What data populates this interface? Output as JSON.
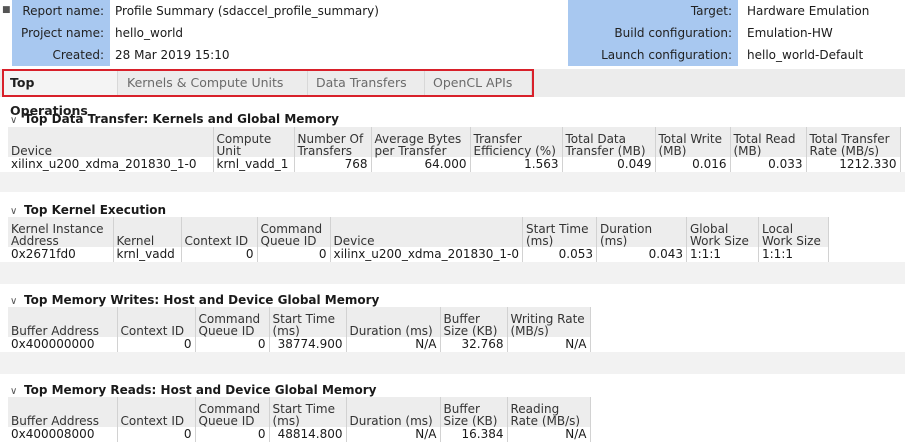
{
  "header": {
    "report_name_label": "Report name:",
    "report_name": "Profile Summary (sdaccel_profile_summary)",
    "project_name_label": "Project name:",
    "project_name": "hello_world",
    "created_label": "Created:",
    "created": "28 Mar 2019 15:10",
    "target_label": "Target:",
    "target": "Hardware Emulation",
    "build_config_label": "Build configuration:",
    "build_config": "Emulation-HW",
    "launch_config_label": "Launch configuration:",
    "launch_config": "hello_world-Default"
  },
  "tabs": [
    "Top Operations",
    "Kernels & Compute Units",
    "Data Transfers",
    "OpenCL APIs"
  ],
  "sections": {
    "data_transfer": {
      "title": "Top Data Transfer: Kernels and Global Memory",
      "headers": [
        "Device",
        "Compute Unit",
        "Number Of Transfers",
        "Average Bytes per Transfer",
        "Transfer Efficiency (%)",
        "Total Data Transfer (MB)",
        "Total Write (MB)",
        "Total Read (MB)",
        "Total Transfer Rate (MB/s)"
      ],
      "rows": [
        [
          "xilinx_u200_xdma_201830_1-0",
          "krnl_vadd_1",
          "768",
          "64.000",
          "1.563",
          "0.049",
          "0.016",
          "0.033",
          "1212.330"
        ]
      ]
    },
    "kernel_exec": {
      "title": "Top Kernel Execution",
      "headers": [
        "Kernel Instance Address",
        "Kernel",
        "Context ID",
        "Command Queue ID",
        "Device",
        "Start Time (ms)",
        "Duration (ms)",
        "Global Work Size",
        "Local Work Size"
      ],
      "rows": [
        [
          "0x2671fd0",
          "krnl_vadd",
          "0",
          "0",
          "xilinx_u200_xdma_201830_1-0",
          "0.053",
          "0.043",
          "1:1:1",
          "1:1:1"
        ]
      ]
    },
    "mem_writes": {
      "title": "Top Memory Writes: Host and Device Global Memory",
      "headers": [
        "Buffer Address",
        "Context ID",
        "Command Queue ID",
        "Start Time (ms)",
        "Duration (ms)",
        "Buffer Size (KB)",
        "Writing Rate (MB/s)"
      ],
      "rows": [
        [
          "0x400000000",
          "0",
          "0",
          "38774.900",
          "N/A",
          "32.768",
          "N/A"
        ]
      ]
    },
    "mem_reads": {
      "title": "Top Memory Reads: Host and Device Global Memory",
      "headers": [
        "Buffer Address",
        "Context ID",
        "Command Queue ID",
        "Start Time (ms)",
        "Duration (ms)",
        "Buffer Size (KB)",
        "Reading Rate (MB/s)"
      ],
      "rows": [
        [
          "0x400008000",
          "0",
          "0",
          "48814.800",
          "N/A",
          "16.384",
          "N/A"
        ]
      ]
    }
  },
  "colors": {
    "header_label_bg": "#a8c8f0",
    "tab_outline": "#d8202a"
  }
}
